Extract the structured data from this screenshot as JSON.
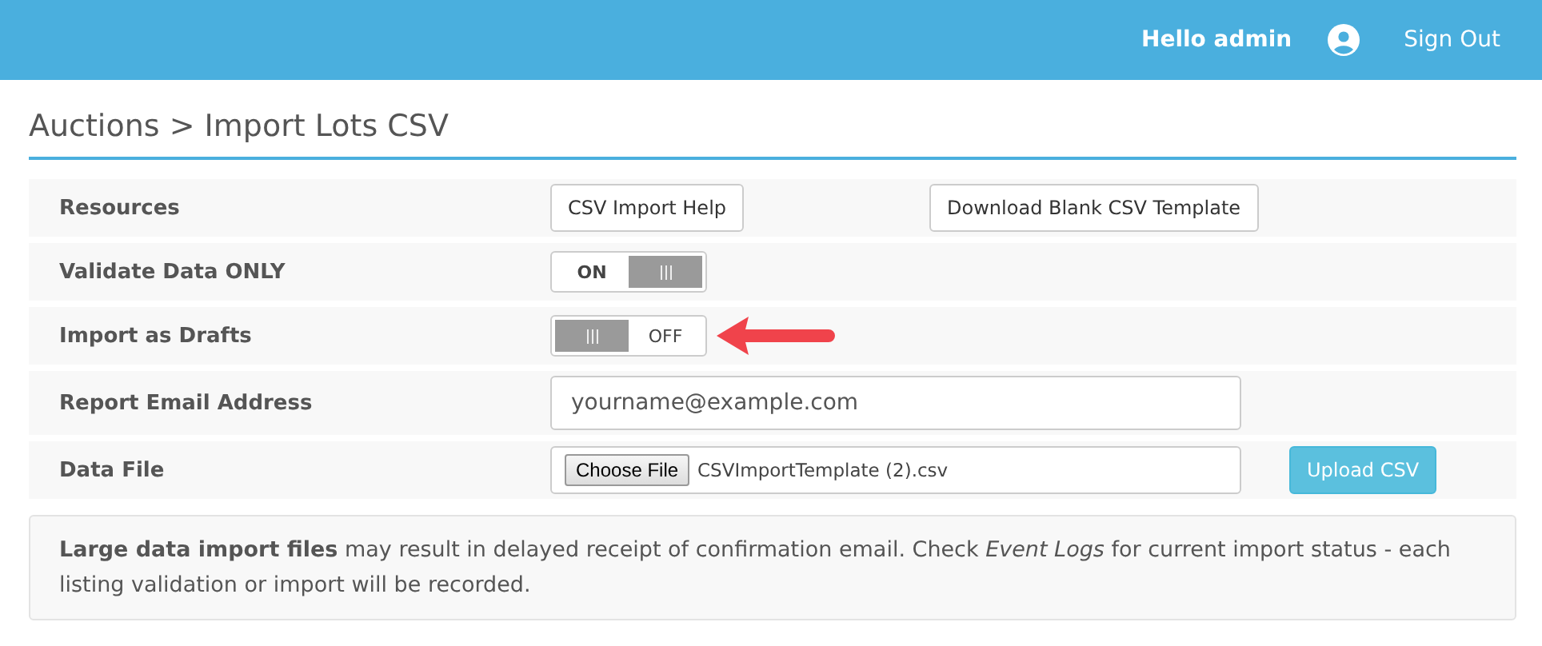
{
  "header": {
    "greeting": "Hello admin",
    "sign_out": "Sign Out"
  },
  "page_title": "Auctions > Import Lots CSV",
  "rows": [
    {
      "kind": "buttons",
      "label": "Resources",
      "buttons": [
        "CSV Import Help",
        "Download Blank CSV Template"
      ]
    },
    {
      "kind": "toggle",
      "label": "Validate Data ONLY",
      "on": true,
      "text": "ON",
      "pointed_at": false
    },
    {
      "kind": "toggle",
      "label": "Import as Drafts",
      "on": false,
      "text": "OFF",
      "pointed_at": true
    },
    {
      "kind": "field",
      "label": "Report Email Address",
      "placeholder": "yourname@example.com"
    },
    {
      "kind": "file",
      "label": "Data File",
      "choose": "Choose File",
      "file_name": "CSVImportTemplate (2).csv",
      "upload": "Upload CSV"
    }
  ],
  "notice": "**Large data import files** may result in delayed receipt of confirmation email. Check *Event Logs* for current import status - each listing validation or import will be recorded."
}
